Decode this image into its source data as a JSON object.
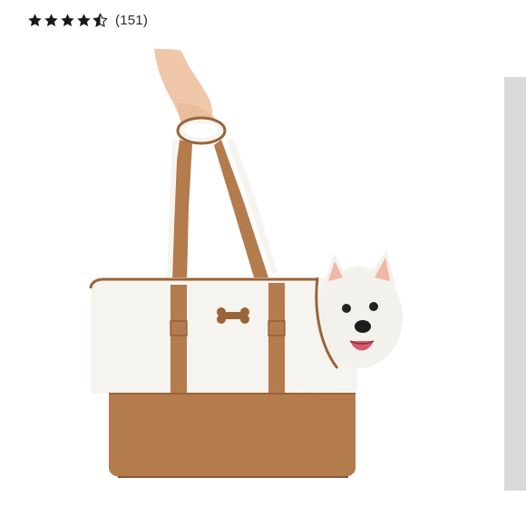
{
  "rating": {
    "value": 4.5,
    "max": 5,
    "count_text": "(151)",
    "star_color": "#1a1a1a"
  },
  "product_image": {
    "icons": [
      "hand",
      "pet-carrier-tote",
      "bone-patch",
      "dog"
    ],
    "colors": {
      "fleece": "#f6f4ef",
      "suede": "#b47b4d",
      "suede_dark": "#9a6439",
      "dog": "#f3f1ec"
    }
  },
  "scroll_strip": {
    "color": "#d9d9d9"
  }
}
